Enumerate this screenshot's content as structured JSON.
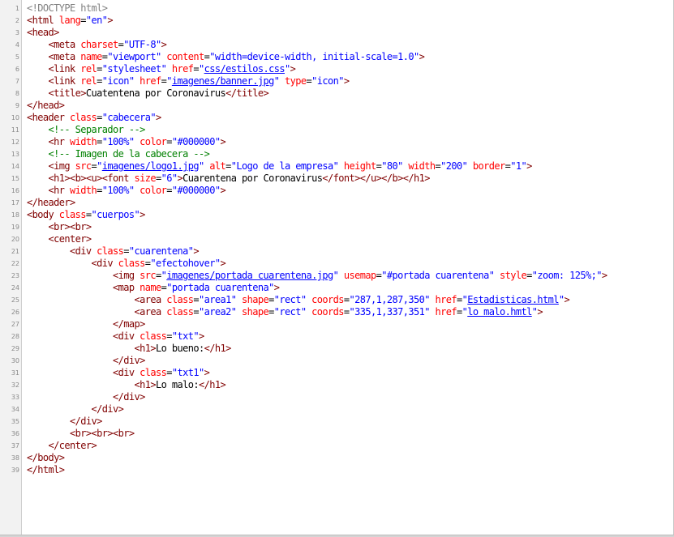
{
  "editor": {
    "lines": [
      {
        "n": "1",
        "tokens": [
          {
            "t": "<!DOCTYPE html>",
            "k": "d"
          }
        ]
      },
      {
        "n": "2",
        "tokens": [
          {
            "t": "<html",
            "k": "t"
          },
          {
            "t": " lang",
            "k": "a"
          },
          {
            "t": "=",
            "k": "p"
          },
          {
            "t": "\"en\"",
            "k": "v"
          },
          {
            "t": ">",
            "k": "t"
          }
        ]
      },
      {
        "n": "3",
        "tokens": [
          {
            "t": "<head>",
            "k": "t"
          }
        ]
      },
      {
        "n": "4",
        "tokens": [
          {
            "t": "    ",
            "k": "p"
          },
          {
            "t": "<meta",
            "k": "t"
          },
          {
            "t": " charset",
            "k": "a"
          },
          {
            "t": "=",
            "k": "p"
          },
          {
            "t": "\"UTF-8\"",
            "k": "v"
          },
          {
            "t": ">",
            "k": "t"
          }
        ]
      },
      {
        "n": "5",
        "tokens": [
          {
            "t": "    ",
            "k": "p"
          },
          {
            "t": "<meta",
            "k": "t"
          },
          {
            "t": " name",
            "k": "a"
          },
          {
            "t": "=",
            "k": "p"
          },
          {
            "t": "\"viewport\"",
            "k": "v"
          },
          {
            "t": " content",
            "k": "a"
          },
          {
            "t": "=",
            "k": "p"
          },
          {
            "t": "\"width=device-width, initial-scale=1.0\"",
            "k": "v"
          },
          {
            "t": ">",
            "k": "t"
          }
        ]
      },
      {
        "n": "6",
        "tokens": [
          {
            "t": "    ",
            "k": "p"
          },
          {
            "t": "<link",
            "k": "t"
          },
          {
            "t": " rel",
            "k": "a"
          },
          {
            "t": "=",
            "k": "p"
          },
          {
            "t": "\"stylesheet\"",
            "k": "v"
          },
          {
            "t": " href",
            "k": "a"
          },
          {
            "t": "=",
            "k": "p"
          },
          {
            "t": "\"",
            "k": "v"
          },
          {
            "t": "css/estilos.css",
            "k": "u"
          },
          {
            "t": "\"",
            "k": "v"
          },
          {
            "t": ">",
            "k": "t"
          }
        ]
      },
      {
        "n": "7",
        "tokens": [
          {
            "t": "    ",
            "k": "p"
          },
          {
            "t": "<link",
            "k": "t"
          },
          {
            "t": " rel",
            "k": "a"
          },
          {
            "t": "=",
            "k": "p"
          },
          {
            "t": "\"icon\"",
            "k": "v"
          },
          {
            "t": " href",
            "k": "a"
          },
          {
            "t": "=",
            "k": "p"
          },
          {
            "t": "\"",
            "k": "v"
          },
          {
            "t": "imagenes/banner.jpg",
            "k": "u"
          },
          {
            "t": "\"",
            "k": "v"
          },
          {
            "t": " type",
            "k": "a"
          },
          {
            "t": "=",
            "k": "p"
          },
          {
            "t": "\"icon\"",
            "k": "v"
          },
          {
            "t": ">",
            "k": "t"
          }
        ]
      },
      {
        "n": "8",
        "tokens": [
          {
            "t": "    ",
            "k": "p"
          },
          {
            "t": "<title>",
            "k": "t"
          },
          {
            "t": "Cuatentena por Coronavirus",
            "k": "p"
          },
          {
            "t": "</title>",
            "k": "t"
          }
        ]
      },
      {
        "n": "9",
        "tokens": [
          {
            "t": "</head>",
            "k": "t"
          }
        ]
      },
      {
        "n": "10",
        "tokens": [
          {
            "t": "<header",
            "k": "t"
          },
          {
            "t": " class",
            "k": "a"
          },
          {
            "t": "=",
            "k": "p"
          },
          {
            "t": "\"cabecera\"",
            "k": "v"
          },
          {
            "t": ">",
            "k": "t"
          }
        ]
      },
      {
        "n": "11",
        "tokens": [
          {
            "t": "    ",
            "k": "p"
          },
          {
            "t": "<!-- Separador -->",
            "k": "c"
          }
        ]
      },
      {
        "n": "12",
        "tokens": [
          {
            "t": "    ",
            "k": "p"
          },
          {
            "t": "<hr",
            "k": "t"
          },
          {
            "t": " width",
            "k": "a"
          },
          {
            "t": "=",
            "k": "p"
          },
          {
            "t": "\"100%\"",
            "k": "v"
          },
          {
            "t": " color",
            "k": "a"
          },
          {
            "t": "=",
            "k": "p"
          },
          {
            "t": "\"#000000\"",
            "k": "v"
          },
          {
            "t": ">",
            "k": "t"
          }
        ]
      },
      {
        "n": "13",
        "tokens": [
          {
            "t": "    ",
            "k": "p"
          },
          {
            "t": "<!-- Imagen de la cabecera -->",
            "k": "c"
          }
        ]
      },
      {
        "n": "14",
        "tokens": [
          {
            "t": "    ",
            "k": "p"
          },
          {
            "t": "<img",
            "k": "t"
          },
          {
            "t": " src",
            "k": "a"
          },
          {
            "t": "=",
            "k": "p"
          },
          {
            "t": "\"",
            "k": "v"
          },
          {
            "t": "imagenes/logo1.jpg",
            "k": "u"
          },
          {
            "t": "\"",
            "k": "v"
          },
          {
            "t": " alt",
            "k": "a"
          },
          {
            "t": "=",
            "k": "p"
          },
          {
            "t": "\"Logo de la empresa\"",
            "k": "v"
          },
          {
            "t": " height",
            "k": "a"
          },
          {
            "t": "=",
            "k": "p"
          },
          {
            "t": "\"80\"",
            "k": "v"
          },
          {
            "t": " width",
            "k": "a"
          },
          {
            "t": "=",
            "k": "p"
          },
          {
            "t": "\"200\"",
            "k": "v"
          },
          {
            "t": " border",
            "k": "a"
          },
          {
            "t": "=",
            "k": "p"
          },
          {
            "t": "\"1\"",
            "k": "v"
          },
          {
            "t": ">",
            "k": "t"
          }
        ]
      },
      {
        "n": "15",
        "tokens": [
          {
            "t": "    ",
            "k": "p"
          },
          {
            "t": "<h1><b><u><font",
            "k": "t"
          },
          {
            "t": " size",
            "k": "a"
          },
          {
            "t": "=",
            "k": "p"
          },
          {
            "t": "\"6\"",
            "k": "v"
          },
          {
            "t": ">",
            "k": "t"
          },
          {
            "t": "Cuarentena por Coronavirus",
            "k": "p"
          },
          {
            "t": "</font></u></b></h1>",
            "k": "t"
          }
        ]
      },
      {
        "n": "16",
        "tokens": [
          {
            "t": "    ",
            "k": "p"
          },
          {
            "t": "<hr",
            "k": "t"
          },
          {
            "t": " width",
            "k": "a"
          },
          {
            "t": "=",
            "k": "p"
          },
          {
            "t": "\"100%\"",
            "k": "v"
          },
          {
            "t": " color",
            "k": "a"
          },
          {
            "t": "=",
            "k": "p"
          },
          {
            "t": "\"#000000\"",
            "k": "v"
          },
          {
            "t": ">",
            "k": "t"
          }
        ]
      },
      {
        "n": "17",
        "tokens": [
          {
            "t": "</header>",
            "k": "t"
          }
        ]
      },
      {
        "n": "18",
        "tokens": [
          {
            "t": "<body",
            "k": "t"
          },
          {
            "t": " class",
            "k": "a"
          },
          {
            "t": "=",
            "k": "p"
          },
          {
            "t": "\"cuerpos\"",
            "k": "v"
          },
          {
            "t": ">",
            "k": "t"
          }
        ]
      },
      {
        "n": "19",
        "tokens": [
          {
            "t": "    ",
            "k": "p"
          },
          {
            "t": "<br><br>",
            "k": "t"
          }
        ]
      },
      {
        "n": "20",
        "tokens": [
          {
            "t": "    ",
            "k": "p"
          },
          {
            "t": "<center>",
            "k": "t"
          }
        ]
      },
      {
        "n": "21",
        "tokens": [
          {
            "t": "        ",
            "k": "p"
          },
          {
            "t": "<div",
            "k": "t"
          },
          {
            "t": " class",
            "k": "a"
          },
          {
            "t": "=",
            "k": "p"
          },
          {
            "t": "\"cuarentena\"",
            "k": "v"
          },
          {
            "t": ">",
            "k": "t"
          }
        ]
      },
      {
        "n": "22",
        "tokens": [
          {
            "t": "            ",
            "k": "p"
          },
          {
            "t": "<div",
            "k": "t"
          },
          {
            "t": " class",
            "k": "a"
          },
          {
            "t": "=",
            "k": "p"
          },
          {
            "t": "\"efectohover\"",
            "k": "v"
          },
          {
            "t": ">",
            "k": "t"
          }
        ]
      },
      {
        "n": "23",
        "tokens": [
          {
            "t": "                ",
            "k": "p"
          },
          {
            "t": "<img",
            "k": "t"
          },
          {
            "t": " src",
            "k": "a"
          },
          {
            "t": "=",
            "k": "p"
          },
          {
            "t": "\"",
            "k": "v"
          },
          {
            "t": "imagenes/portada cuarentena.jpg",
            "k": "u"
          },
          {
            "t": "\"",
            "k": "v"
          },
          {
            "t": " usemap",
            "k": "a"
          },
          {
            "t": "=",
            "k": "p"
          },
          {
            "t": "\"#portada cuarentena\"",
            "k": "v"
          },
          {
            "t": " style",
            "k": "a"
          },
          {
            "t": "=",
            "k": "p"
          },
          {
            "t": "\"zoom: 125%;\"",
            "k": "v"
          },
          {
            "t": ">",
            "k": "t"
          }
        ]
      },
      {
        "n": "24",
        "tokens": [
          {
            "t": "                ",
            "k": "p"
          },
          {
            "t": "<map",
            "k": "t"
          },
          {
            "t": " name",
            "k": "a"
          },
          {
            "t": "=",
            "k": "p"
          },
          {
            "t": "\"portada cuarentena\"",
            "k": "v"
          },
          {
            "t": ">",
            "k": "t"
          }
        ]
      },
      {
        "n": "25",
        "tokens": [
          {
            "t": "                    ",
            "k": "p"
          },
          {
            "t": "<area",
            "k": "t"
          },
          {
            "t": " class",
            "k": "a"
          },
          {
            "t": "=",
            "k": "p"
          },
          {
            "t": "\"area1\"",
            "k": "v"
          },
          {
            "t": " shape",
            "k": "a"
          },
          {
            "t": "=",
            "k": "p"
          },
          {
            "t": "\"rect\"",
            "k": "v"
          },
          {
            "t": " coords",
            "k": "a"
          },
          {
            "t": "=",
            "k": "p"
          },
          {
            "t": "\"287,1,287,350\"",
            "k": "v"
          },
          {
            "t": " href",
            "k": "a"
          },
          {
            "t": "=",
            "k": "p"
          },
          {
            "t": "\"",
            "k": "v"
          },
          {
            "t": "Estadisticas.html",
            "k": "u"
          },
          {
            "t": "\"",
            "k": "v"
          },
          {
            "t": ">",
            "k": "t"
          }
        ]
      },
      {
        "n": "26",
        "tokens": [
          {
            "t": "                    ",
            "k": "p"
          },
          {
            "t": "<area",
            "k": "t"
          },
          {
            "t": " class",
            "k": "a"
          },
          {
            "t": "=",
            "k": "p"
          },
          {
            "t": "\"area2\"",
            "k": "v"
          },
          {
            "t": " shape",
            "k": "a"
          },
          {
            "t": "=",
            "k": "p"
          },
          {
            "t": "\"rect\"",
            "k": "v"
          },
          {
            "t": " coords",
            "k": "a"
          },
          {
            "t": "=",
            "k": "p"
          },
          {
            "t": "\"335,1,337,351\"",
            "k": "v"
          },
          {
            "t": " href",
            "k": "a"
          },
          {
            "t": "=",
            "k": "p"
          },
          {
            "t": "\"",
            "k": "v"
          },
          {
            "t": "lo malo.hmtl",
            "k": "u"
          },
          {
            "t": "\"",
            "k": "v"
          },
          {
            "t": ">",
            "k": "t"
          }
        ]
      },
      {
        "n": "27",
        "tokens": [
          {
            "t": "                ",
            "k": "p"
          },
          {
            "t": "</map>",
            "k": "t"
          }
        ]
      },
      {
        "n": "28",
        "tokens": [
          {
            "t": "                ",
            "k": "p"
          },
          {
            "t": "<div",
            "k": "t"
          },
          {
            "t": " class",
            "k": "a"
          },
          {
            "t": "=",
            "k": "p"
          },
          {
            "t": "\"txt\"",
            "k": "v"
          },
          {
            "t": ">",
            "k": "t"
          }
        ]
      },
      {
        "n": "29",
        "tokens": [
          {
            "t": "                    ",
            "k": "p"
          },
          {
            "t": "<h1>",
            "k": "t"
          },
          {
            "t": "Lo bueno:",
            "k": "p"
          },
          {
            "t": "</h1>",
            "k": "t"
          }
        ]
      },
      {
        "n": "30",
        "tokens": [
          {
            "t": "                ",
            "k": "p"
          },
          {
            "t": "</div>",
            "k": "t"
          }
        ]
      },
      {
        "n": "31",
        "tokens": [
          {
            "t": "                ",
            "k": "p"
          },
          {
            "t": "<div",
            "k": "t"
          },
          {
            "t": " class",
            "k": "a"
          },
          {
            "t": "=",
            "k": "p"
          },
          {
            "t": "\"txt1\"",
            "k": "v"
          },
          {
            "t": ">",
            "k": "t"
          }
        ]
      },
      {
        "n": "32",
        "tokens": [
          {
            "t": "                    ",
            "k": "p"
          },
          {
            "t": "<h1>",
            "k": "t"
          },
          {
            "t": "Lo malo:",
            "k": "p"
          },
          {
            "t": "</h1>",
            "k": "t"
          }
        ]
      },
      {
        "n": "33",
        "tokens": [
          {
            "t": "                ",
            "k": "p"
          },
          {
            "t": "</div>",
            "k": "t"
          }
        ]
      },
      {
        "n": "34",
        "tokens": [
          {
            "t": "            ",
            "k": "p"
          },
          {
            "t": "</div>",
            "k": "t"
          }
        ]
      },
      {
        "n": "35",
        "tokens": [
          {
            "t": "        ",
            "k": "p"
          },
          {
            "t": "</div>",
            "k": "t"
          }
        ]
      },
      {
        "n": "36",
        "tokens": [
          {
            "t": "        ",
            "k": "p"
          },
          {
            "t": "<br><br><br>",
            "k": "t"
          }
        ]
      },
      {
        "n": "37",
        "tokens": [
          {
            "t": "    ",
            "k": "p"
          },
          {
            "t": "</center>",
            "k": "t"
          }
        ]
      },
      {
        "n": "38",
        "tokens": [
          {
            "t": "</body>",
            "k": "t"
          }
        ]
      },
      {
        "n": "39",
        "tokens": [
          {
            "t": "</html>",
            "k": "t"
          }
        ]
      }
    ]
  },
  "syntax_colors": {
    "tag": "#800000",
    "attribute": "#ff0000",
    "value": "#0000ff",
    "comment": "#008000",
    "doctype": "#808080",
    "text": "#000000"
  }
}
